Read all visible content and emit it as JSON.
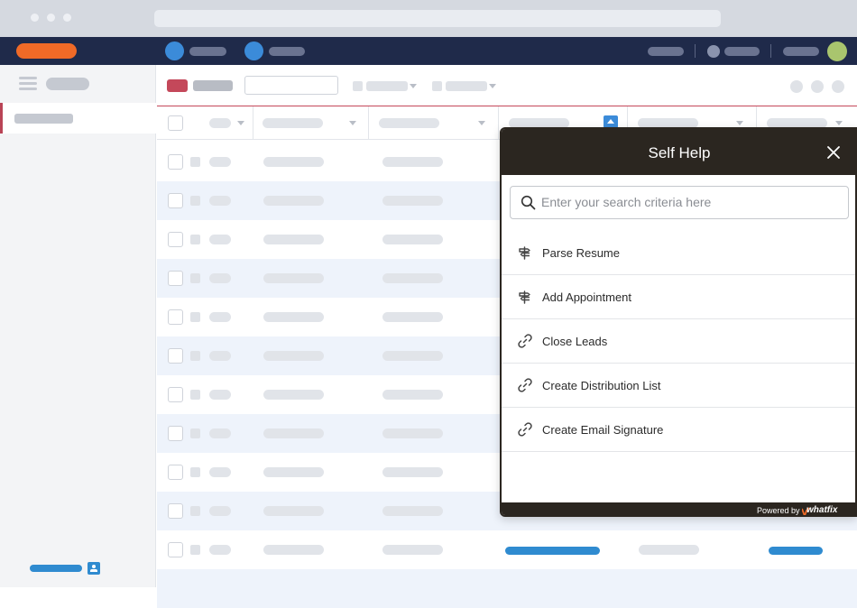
{
  "colors": {
    "nav_bg": "#1f2a4a",
    "accent_orange": "#f06a27",
    "accent_blue": "#3b8bd9",
    "accent_red": "#c4485a",
    "panel_dark": "#2b2620",
    "avatar_green": "#a9c56e"
  },
  "self_help": {
    "title": "Self Help",
    "search_placeholder": "Enter your search criteria here",
    "items": [
      {
        "label": "Parse Resume",
        "icon": "signpost-icon"
      },
      {
        "label": "Add Appointment",
        "icon": "signpost-icon"
      },
      {
        "label": "Close Leads",
        "icon": "link-icon"
      },
      {
        "label": "Create Distribution List",
        "icon": "link-icon"
      },
      {
        "label": "Create Email Signature",
        "icon": "link-icon"
      }
    ],
    "footer": {
      "powered_by": "Powered by",
      "brand": "whatfix"
    }
  }
}
